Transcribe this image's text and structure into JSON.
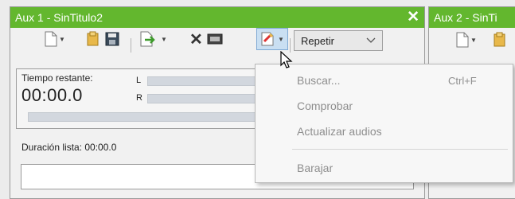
{
  "panel1": {
    "title": "Aux 1 - SinTitulo2",
    "close_label": "✕",
    "repeat_value": "Repetir",
    "time_label": "Tiempo restante:",
    "time_value": "00:00.0",
    "channel_left": "L",
    "channel_right": "R",
    "duration_label": "Duración lista: 00:00.0"
  },
  "panel2": {
    "title": "Aux 2 - SinTi"
  },
  "context_menu": {
    "items": [
      {
        "label": "Buscar...",
        "shortcut": "Ctrl+F"
      },
      {
        "label": "Comprobar"
      },
      {
        "label": "Actualizar audios"
      },
      {
        "label": "Barajar"
      }
    ]
  },
  "colors": {
    "titlebar": "#63b72e",
    "menu_text_disabled": "#8e8e8e"
  }
}
